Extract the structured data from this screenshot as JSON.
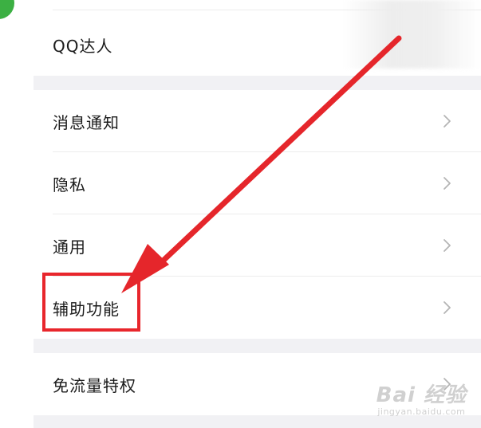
{
  "colors": {
    "highlight": "#e8262c",
    "arrow": "#e5262b",
    "section_gap": "#f1f1f4",
    "text": "#1b1b1b",
    "chevron": "#b5b5b5"
  },
  "settings": {
    "top_item": {
      "label": "QQ达人"
    },
    "group2": [
      {
        "label": "消息通知",
        "icon": "chevron-right-icon"
      },
      {
        "label": "隐私",
        "icon": "chevron-right-icon"
      },
      {
        "label": "通用",
        "icon": "chevron-right-icon"
      },
      {
        "label": "辅助功能",
        "icon": "chevron-right-icon"
      }
    ],
    "group3": [
      {
        "label": "免流量特权",
        "icon": "chevron-right-icon"
      }
    ]
  },
  "watermark": {
    "main": "Bai  经验",
    "sub": "jingyan.baidu.com"
  }
}
